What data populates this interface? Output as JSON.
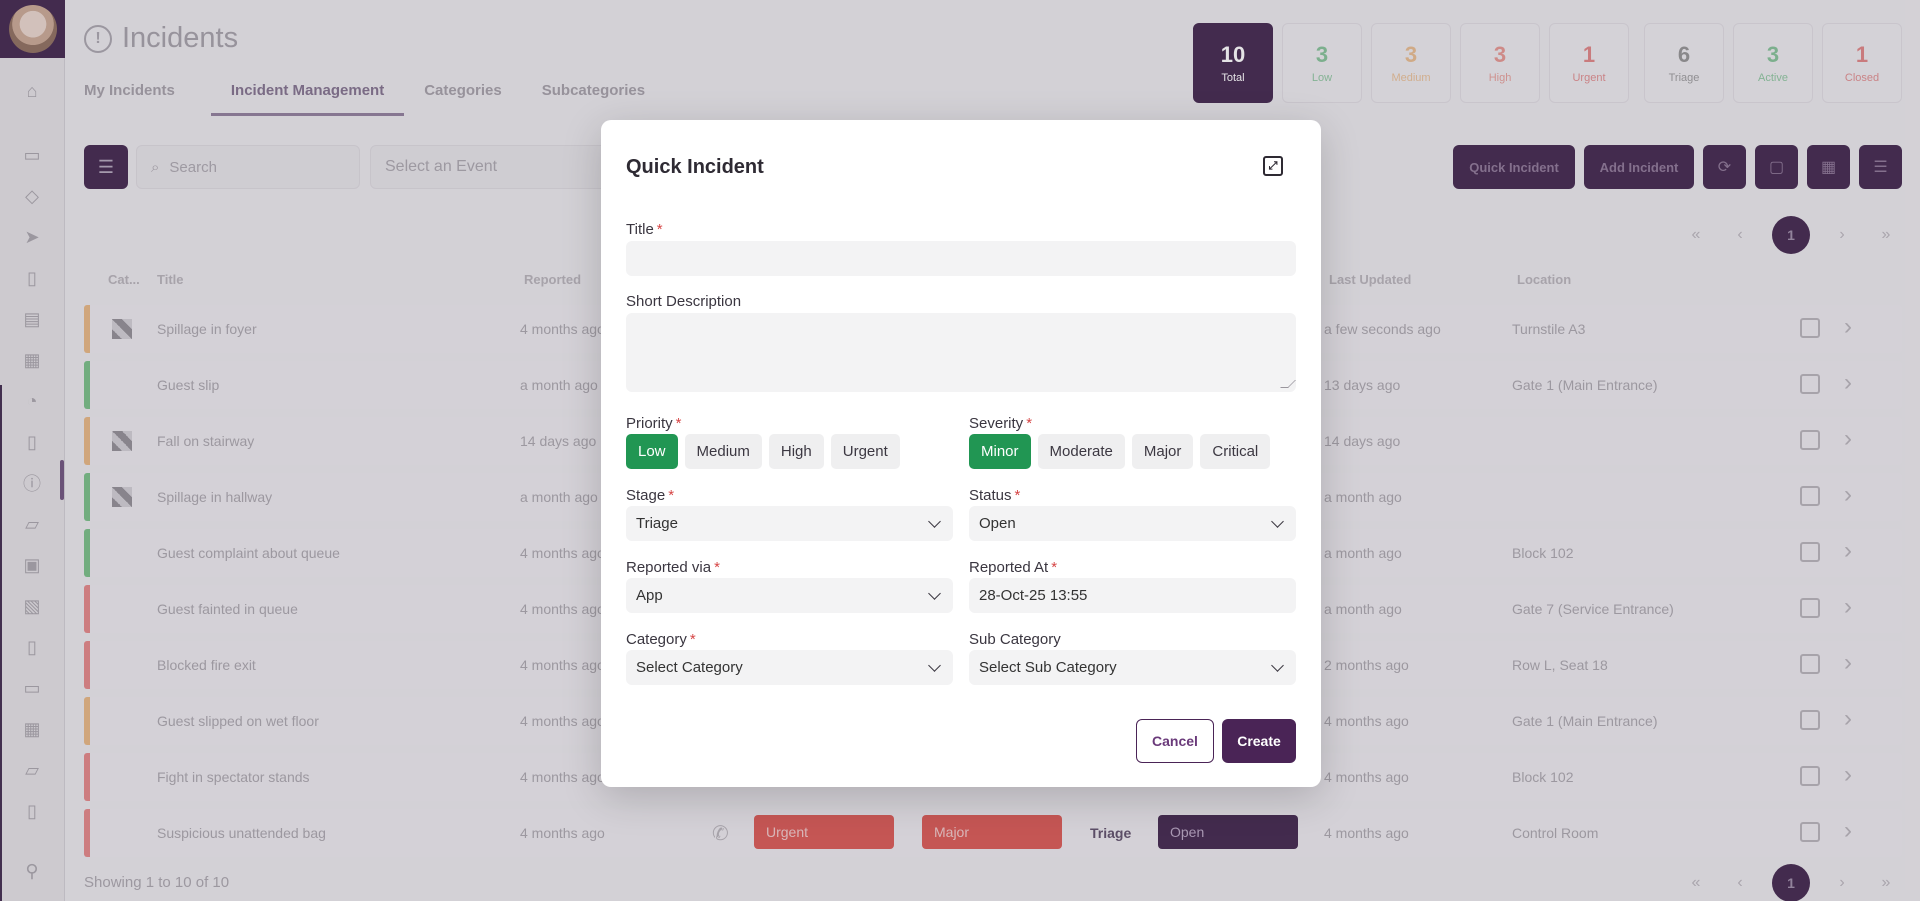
{
  "page": {
    "title": "Incidents",
    "tabs": [
      "My Incidents",
      "Incident Management",
      "Categories",
      "Subcategories"
    ]
  },
  "stats": [
    {
      "num": "10",
      "label": "Total",
      "color": "#ffffff"
    },
    {
      "num": "3",
      "label": "Low",
      "color": "#3aa55a"
    },
    {
      "num": "3",
      "label": "Medium",
      "color": "#e59a4a"
    },
    {
      "num": "3",
      "label": "High",
      "color": "#e05a4e"
    },
    {
      "num": "1",
      "label": "Urgent",
      "color": "#d63a3a"
    },
    {
      "num": "6",
      "label": "Triage",
      "color": "#555555"
    },
    {
      "num": "3",
      "label": "Active",
      "color": "#3aa55a"
    },
    {
      "num": "1",
      "label": "Closed",
      "color": "#d63a3a"
    }
  ],
  "toolbar": {
    "search_placeholder": "Search",
    "event_placeholder": "Select an Event",
    "quick_incident": "Quick Incident",
    "add_incident": "Add Incident"
  },
  "pager": {
    "current": "1"
  },
  "table": {
    "headers": {
      "cat": "Cat...",
      "title": "Title",
      "reported": "Reported",
      "updated": "Last Updated",
      "location": "Location"
    },
    "rows": [
      {
        "title": "Spillage in foyer",
        "reported": "4 months ago",
        "updated": "a few seconds ago",
        "location": "Turnstile A3",
        "bar": "#e5a35a",
        "icon": true
      },
      {
        "title": "Guest slip",
        "reported": "a month ago",
        "updated": "13 days ago",
        "location": "Gate 1 (Main Entrance)",
        "bar": "#4caf5f",
        "icon": false
      },
      {
        "title": "Fall on stairway",
        "reported": "14 days ago",
        "updated": "14 days ago",
        "location": "",
        "bar": "#e5a35a",
        "icon": true
      },
      {
        "title": "Spillage in hallway",
        "reported": "a month ago",
        "updated": "a month ago",
        "location": "",
        "bar": "#4caf5f",
        "icon": true
      },
      {
        "title": "Guest complaint about queue",
        "reported": "4 months ago",
        "updated": "a month ago",
        "location": "Block 102",
        "bar": "#4caf5f",
        "icon": false
      },
      {
        "title": "Guest fainted in queue",
        "reported": "4 months ago",
        "updated": "a month ago",
        "location": "Gate 7 (Service Entrance)",
        "bar": "#e06060",
        "icon": false
      },
      {
        "title": "Blocked fire exit",
        "reported": "4 months ago",
        "updated": "2 months ago",
        "location": "Row L, Seat 18",
        "bar": "#e06060",
        "icon": false
      },
      {
        "title": "Guest slipped on wet floor",
        "reported": "4 months ago",
        "updated": "4 months ago",
        "location": "Gate 1 (Main Entrance)",
        "bar": "#e5a35a",
        "icon": false
      },
      {
        "title": "Fight in spectator stands",
        "reported": "4 months ago",
        "updated": "4 months ago",
        "location": "Block 102",
        "bar": "#e06060",
        "icon": false
      },
      {
        "title": "Suspicious unattended bag",
        "reported": "4 months ago",
        "updated": "4 months ago",
        "location": "Control Room",
        "bar": "#e06060",
        "icon": false,
        "priority": "Urgent",
        "severity": "Major",
        "stage": "Triage",
        "status": "Open"
      }
    ],
    "footer": "Showing 1 to 10 of 10"
  },
  "modal": {
    "title": "Quick Incident",
    "title_label": "Title",
    "title_value": "",
    "desc_label": "Short Description",
    "desc_value": "",
    "priority_label": "Priority",
    "priority_options": [
      "Low",
      "Medium",
      "High",
      "Urgent"
    ],
    "priority_selected": "Low",
    "severity_label": "Severity",
    "severity_options": [
      "Minor",
      "Moderate",
      "Major",
      "Critical"
    ],
    "severity_selected": "Minor",
    "stage_label": "Stage",
    "stage_value": "Triage",
    "status_label": "Status",
    "status_value": "Open",
    "reported_via_label": "Reported via",
    "reported_via_value": "App",
    "reported_at_label": "Reported At",
    "reported_at_value": "28-Oct-25 13:55",
    "category_label": "Category",
    "category_value": "Select Category",
    "subcategory_label": "Sub Category",
    "subcategory_value": "Select Sub Category",
    "cancel_label": "Cancel",
    "create_label": "Create",
    "required_mark": "*"
  }
}
